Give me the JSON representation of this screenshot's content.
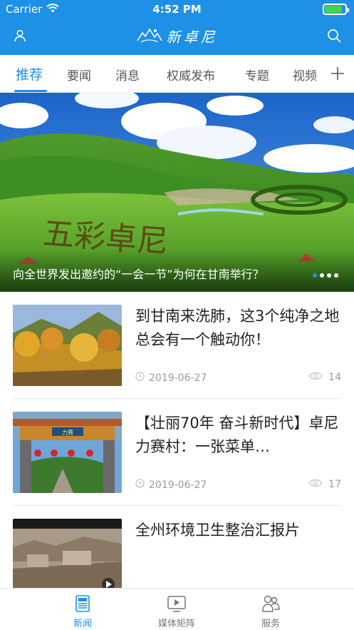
{
  "status_bar": {
    "carrier": "Carrier",
    "time": "4:52 PM",
    "battery_level": 0.85
  },
  "header": {
    "title": "新卓尼",
    "left_icon": "user-icon",
    "right_icon": "search-icon",
    "accent_color": "#1E90E6"
  },
  "tabs": {
    "items": [
      {
        "label": "推荐",
        "active": true
      },
      {
        "label": "要闻",
        "active": false
      },
      {
        "label": "消息",
        "active": false
      },
      {
        "label": "权威发布",
        "active": false
      },
      {
        "label": "专题",
        "active": false
      },
      {
        "label": "视频",
        "active": false
      }
    ],
    "add_icon": "plus-icon"
  },
  "hero": {
    "caption": "向全世界发出邀约的“一会一节”为何在甘南举行？",
    "ground_text": "五彩卓尼",
    "pages": 4,
    "current_page": 1
  },
  "news": [
    {
      "title": "到甘南来洗肺，这3个纯净之地总会有一个触动你！",
      "date": "2019-06-27",
      "views": "14"
    },
    {
      "title": "【壮丽70年 奋斗新时代】卓尼力赛村：一张菜单…",
      "date": "2019-06-27",
      "views": "17",
      "sign_text": "力赛"
    },
    {
      "title": "全州环境卫生整治汇报片",
      "date": "",
      "views": ""
    }
  ],
  "bottom_nav": {
    "items": [
      {
        "label": "新闻",
        "icon": "news-icon",
        "active": true
      },
      {
        "label": "媒体矩阵",
        "icon": "video-icon",
        "active": false
      },
      {
        "label": "服务",
        "icon": "service-icon",
        "active": false
      }
    ]
  }
}
